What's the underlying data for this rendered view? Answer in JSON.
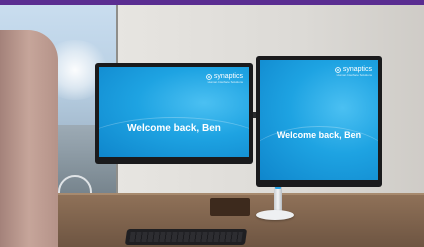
{
  "scene": {
    "top_bar_color": "#5a2d91"
  },
  "monitors": {
    "left": {
      "brand_name": "synaptics",
      "brand_tagline": "Human Interface Solutions",
      "welcome_text": "Welcome back, Ben",
      "screen_color": "#1ea3e2"
    },
    "right": {
      "brand_name": "synaptics",
      "brand_tagline": "Human Interface Solutions",
      "welcome_text": "Welcome back, Ben",
      "screen_color": "#1ea3e2"
    }
  },
  "icons": {
    "brand_logo": "synaptics-logo-icon"
  }
}
